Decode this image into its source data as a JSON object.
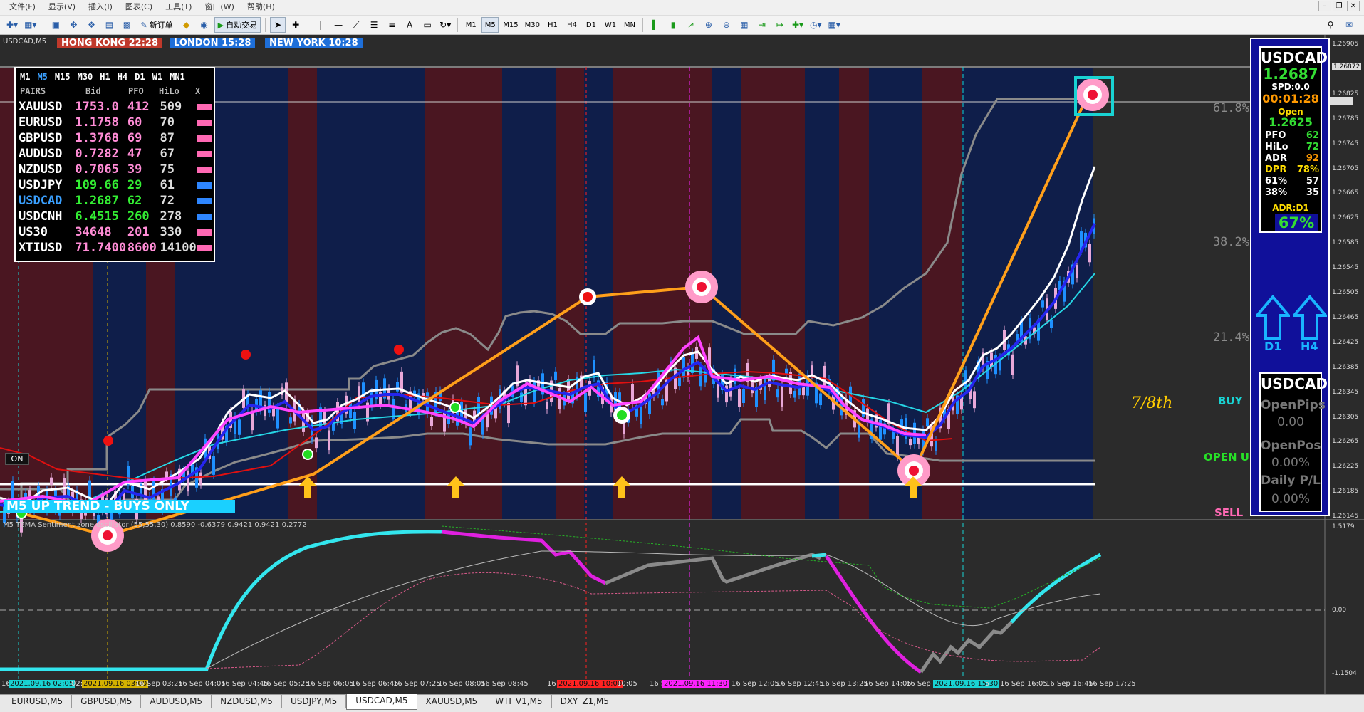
{
  "menu": [
    "文件(F)",
    "显示(V)",
    "插入(I)",
    "图表(C)",
    "工具(T)",
    "窗口(W)",
    "帮助(H)"
  ],
  "toolbar": {
    "new_order": "新订单",
    "auto_trade": "自动交易",
    "timeframes": [
      "M1",
      "M5",
      "M15",
      "M30",
      "H1",
      "H4",
      "D1",
      "W1",
      "MN"
    ],
    "active_tf": "M5"
  },
  "chart": {
    "symbol": "USDCAD,M5",
    "clocks": [
      {
        "label": "HONG KONG 22:28",
        "color": "#c0392b"
      },
      {
        "label": "LONDON  15:28",
        "color": "#1e6fd9"
      },
      {
        "label": "NEW YORK 10:28",
        "color": "#1e6fd9"
      }
    ],
    "pairs_panel": {
      "timeframes": [
        "M1",
        "M5",
        "M15",
        "M30",
        "H1",
        "H4",
        "D1",
        "W1",
        "MN1"
      ],
      "active_tf": "M5",
      "headers": [
        "PAIRS",
        "Bid",
        "PFO",
        "HiLo",
        "X"
      ],
      "rows": [
        {
          "sym": "XAUUSD",
          "bid": "1753.0",
          "pfo": "412",
          "hilo": "509",
          "color": "#ff69b4"
        },
        {
          "sym": "EURUSD",
          "bid": "1.1758",
          "pfo": "60",
          "hilo": "70",
          "color": "#ff69b4"
        },
        {
          "sym": "GBPUSD",
          "bid": "1.3768",
          "pfo": "69",
          "hilo": "87",
          "color": "#ff69b4"
        },
        {
          "sym": "AUDUSD",
          "bid": "0.7282",
          "pfo": "47",
          "hilo": "67",
          "color": "#ff69b4"
        },
        {
          "sym": "NZDUSD",
          "bid": "0.7065",
          "pfo": "39",
          "hilo": "75",
          "color": "#ff69b4"
        },
        {
          "sym": "USDJPY",
          "bid": "109.66",
          "pfo": "29",
          "hilo": "61",
          "color": "#2e86ff"
        },
        {
          "sym": "USDCAD",
          "bid": "1.2687",
          "pfo": "62",
          "hilo": "72",
          "color": "#2e86ff"
        },
        {
          "sym": "USDCNH",
          "bid": "6.4515",
          "pfo": "260",
          "hilo": "278",
          "color": "#2e86ff"
        },
        {
          "sym": "US30",
          "bid": "34648",
          "pfo": "201",
          "hilo": "330",
          "color": "#ff69b4"
        },
        {
          "sym": "XTIUSD",
          "bid": "71.7400",
          "pfo": "8600",
          "hilo": "14100",
          "color": "#ff69b4"
        }
      ]
    },
    "trend_banner": "M5 UP TREND - BUYS ONLY",
    "on_button": "ON",
    "fib_levels": [
      "61.8%",
      "38.2%",
      "21.4%"
    ],
    "seventh_label": "7/8th",
    "signals": {
      "buy": "BUY",
      "open": "OPEN U",
      "sell": "SELL"
    },
    "y_axis": [
      "1.26905",
      "1.26872",
      "1.26825",
      "1.26785",
      "1.26745",
      "1.26705",
      "1.26665",
      "1.26625",
      "1.26585",
      "1.26545",
      "1.26505",
      "1.26465",
      "1.26425",
      "1.26385",
      "1.26345",
      "1.26305",
      "1.26265",
      "1.26225",
      "1.26185",
      "1.26145"
    ],
    "info_panel": {
      "symbol": "USDCAD",
      "price": "1.2687",
      "spread": "SPD:0.0",
      "timer": "00:01:28",
      "open_label": "Open",
      "open_price": "1.2625",
      "stats": [
        {
          "k": "PFO",
          "v": "62",
          "c": "#33dd33"
        },
        {
          "k": "HiLo",
          "v": "72",
          "c": "#33dd33"
        },
        {
          "k": "ADR",
          "v": "92",
          "c": "#ff9900"
        },
        {
          "k": "DPR",
          "v": "78%",
          "c": "#ffdd00",
          "kc": "#ffdd00"
        },
        {
          "k": "61%",
          "v": "57",
          "c": "#fff"
        },
        {
          "k": "38%",
          "v": "35",
          "c": "#fff"
        }
      ],
      "adr_label": "ADR:D1",
      "adr_pct": "67%",
      "arrow_labels": [
        "D1",
        "H4"
      ],
      "box2": {
        "symbol": "USDCAD",
        "open_pips_label": "OpenPips",
        "open_pips": "0.00",
        "open_pos_label": "OpenPos",
        "open_pos": "0.00%",
        "daily_label": "Daily P/L",
        "daily": "0.00%"
      }
    },
    "sub_window": {
      "title": "M5 TEMA Sentiment zone oscillator (55,55,30) 0.8590 -0.6379 0.9421 0.9421 0.2772",
      "y_axis": [
        "1.5179",
        "0.00",
        "-1.1504"
      ]
    },
    "x_axis": [
      {
        "t": "16 S",
        "hl": false
      },
      {
        "t": "2021.09.16 02:05",
        "hl": "#19d3d3"
      },
      {
        "t": "02:05",
        "hl": false
      },
      {
        "t": "2021.09.16 03:00",
        "hl": "#d4b100"
      },
      {
        "t": "16 Sep 03:25",
        "hl": false
      },
      {
        "t": "16 Sep 04:05",
        "hl": false
      },
      {
        "t": "16 Sep 04:45",
        "hl": false
      },
      {
        "t": "16 Sep 05:25",
        "hl": false
      },
      {
        "t": "16 Sep 06:05",
        "hl": false
      },
      {
        "t": "16 Sep 06:45",
        "hl": false
      },
      {
        "t": "16 Sep 07:25",
        "hl": false
      },
      {
        "t": "16 Sep 08:05",
        "hl": false
      },
      {
        "t": "16 Sep 08:45",
        "hl": false
      },
      {
        "t": "16 S",
        "hl": false
      },
      {
        "t": "2021.09.16 10:00",
        "hl": "#ff2222"
      },
      {
        "t": "10:05",
        "hl": false
      },
      {
        "t": "16 Sep 10:45",
        "hl": false
      },
      {
        "t": "2021.09.16 11:30",
        "hl": "#ff22ff"
      },
      {
        "t": "16 Sep 12:05",
        "hl": false
      },
      {
        "t": "16 Sep 12:45",
        "hl": false
      },
      {
        "t": "16 Sep 13:25",
        "hl": false
      },
      {
        "t": "16 Sep 14:05",
        "hl": false
      },
      {
        "t": "16 Sep",
        "hl": false
      },
      {
        "t": "2021.09.16 15:30",
        "hl": "#19d3d3"
      },
      {
        "t": "5",
        "hl": false
      },
      {
        "t": "16 Sep 16:05",
        "hl": false
      },
      {
        "t": "16 Sep 16:45",
        "hl": false
      },
      {
        "t": "16 Sep 17:25",
        "hl": false
      }
    ]
  },
  "tabs": [
    "EURUSD,M5",
    "GBPUSD,M5",
    "AUDUSD,M5",
    "NZDUSD,M5",
    "USDJPY,M5",
    "USDCAD,M5",
    "XAUUSD,M5",
    "WTI_V1,M5",
    "DXY_Z1,M5"
  ],
  "active_tab": "USDCAD,M5"
}
